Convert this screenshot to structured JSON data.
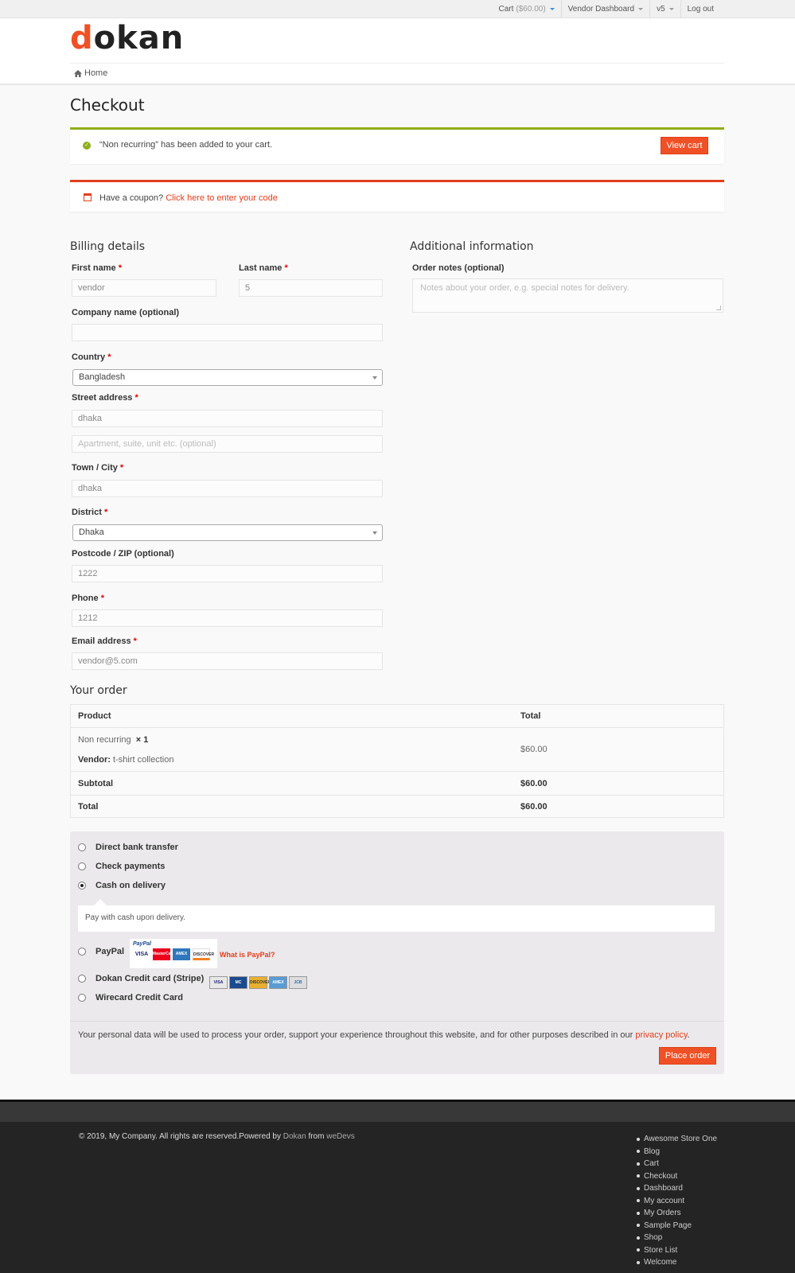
{
  "topbar": {
    "cart_label": "Cart",
    "cart_amount": "($60.00)",
    "vendor_dashboard": "Vendor Dashboard",
    "user": "v5",
    "logout": "Log out"
  },
  "header": {
    "logo_first": "d",
    "logo_rest": "okan",
    "breadcrumb_home": "Home"
  },
  "page": {
    "title": "Checkout"
  },
  "notices": {
    "added_message": "“Non recurring” has been added to your cart.",
    "view_cart": "View cart",
    "coupon_prompt": "Have a coupon?",
    "coupon_link": "Click here to enter your code"
  },
  "billing": {
    "heading": "Billing details",
    "first_name_label": "First name",
    "first_name_value": "vendor",
    "last_name_label": "Last name",
    "last_name_value": "5",
    "company_label": "Company name (optional)",
    "company_value": "",
    "country_label": "Country",
    "country_value": "Bangladesh",
    "street_label": "Street address",
    "street_value": "dhaka",
    "apartment_placeholder": "Apartment, suite, unit etc. (optional)",
    "city_label": "Town / City",
    "city_value": "dhaka",
    "district_label": "District",
    "district_value": "Dhaka",
    "postcode_label": "Postcode / ZIP (optional)",
    "postcode_value": "1222",
    "phone_label": "Phone",
    "phone_value": "1212",
    "email_label": "Email address",
    "email_value": "vendor@5.com",
    "required_mark": "*"
  },
  "additional": {
    "heading": "Additional information",
    "notes_label": "Order notes (optional)",
    "notes_placeholder": "Notes about your order, e.g. special notes for delivery."
  },
  "order": {
    "heading": "Your order",
    "col_product": "Product",
    "col_total": "Total",
    "item_name": "Non recurring",
    "item_qty": "× 1",
    "vendor_label": "Vendor:",
    "vendor_name": "t-shirt collection",
    "item_total": "$60.00",
    "subtotal_label": "Subtotal",
    "subtotal_value": "$60.00",
    "total_label": "Total",
    "total_value": "$60.00"
  },
  "payment": {
    "methods": [
      {
        "label": "Direct bank transfer",
        "selected": false
      },
      {
        "label": "Check payments",
        "selected": false
      },
      {
        "label": "Cash on delivery",
        "selected": true
      },
      {
        "label": "PayPal",
        "selected": false
      },
      {
        "label": "Dokan Credit card (Stripe)",
        "selected": false
      },
      {
        "label": "Wirecard Credit Card",
        "selected": false
      }
    ],
    "cod_description": "Pay with cash upon delivery.",
    "paypal_brand": "PayPal",
    "paypal_cards": [
      "VISA",
      "MasterCard",
      "AMEX",
      "DISCOVER"
    ],
    "what_is_paypal": "What is PayPal?",
    "stripe_cards": [
      "VISA",
      "MC",
      "DISCOVER",
      "AMEX",
      "JCB"
    ],
    "privacy_text": "Your personal data will be used to process your order, support your experience throughout this website, and for other purposes described in our",
    "privacy_link": "privacy policy",
    "privacy_end": ".",
    "place_order": "Place order"
  },
  "footer": {
    "copyright": "© 2019, My Company. All rights are reserved.Powered by",
    "dokan_link": "Dokan",
    "from": "from",
    "wedevs_link": "weDevs",
    "links": [
      "Awesome Store One",
      "Blog",
      "Cart",
      "Checkout",
      "Dashboard",
      "My account",
      "My Orders",
      "Sample Page",
      "Shop",
      "Store List",
      "Welcome"
    ]
  },
  "colors": {
    "brand": "#f05025",
    "success": "#8fae1b",
    "link": "#e2401c"
  }
}
